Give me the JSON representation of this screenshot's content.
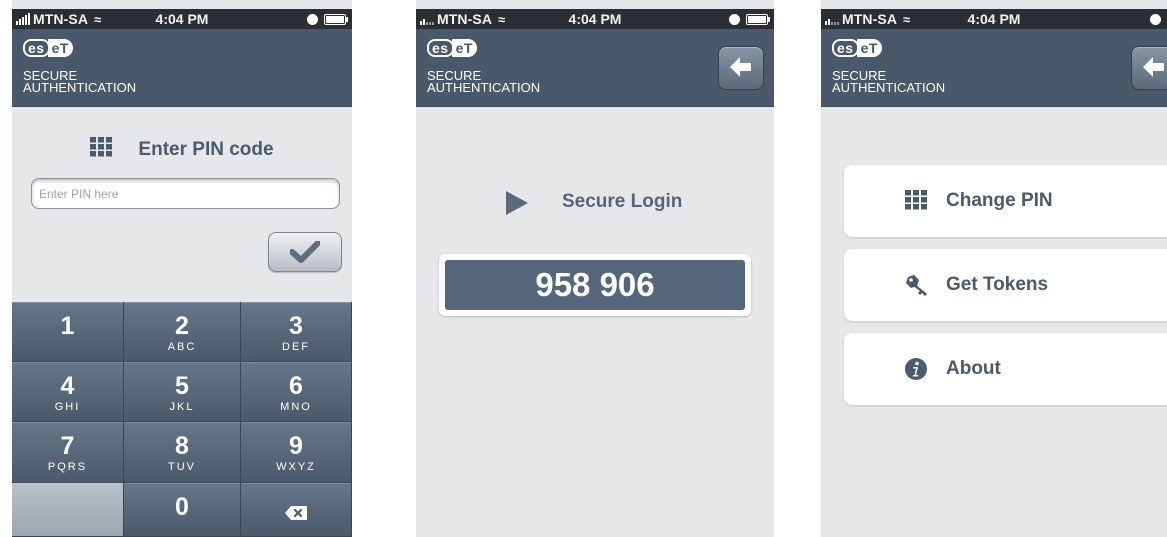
{
  "status_bar": {
    "screen1": {
      "carrier": "MTN-SA",
      "time": "4:04 PM"
    },
    "screen2": {
      "carrier": "MTN-SA",
      "time": "4:04 PM"
    },
    "screen3": {
      "carrier": "MTN-SA",
      "time": "4:04 PM"
    }
  },
  "header": {
    "logo_left": "es",
    "logo_right": "eT",
    "brand_line1": "SECURE",
    "brand_line2": "AUTHENTICATION",
    "back_icon": "left-arrow-icon"
  },
  "pin_screen": {
    "title": "Enter PIN code",
    "title_icon": "keypad-grid-icon",
    "input_placeholder": "Enter PIN here",
    "input_value": "",
    "confirm_icon": "checkmark-icon",
    "keys": [
      {
        "num": "1",
        "letters": ""
      },
      {
        "num": "2",
        "letters": "ABC"
      },
      {
        "num": "3",
        "letters": "DEF"
      },
      {
        "num": "4",
        "letters": "GHI"
      },
      {
        "num": "5",
        "letters": "JKL"
      },
      {
        "num": "6",
        "letters": "MNO"
      },
      {
        "num": "7",
        "letters": "PQRS"
      },
      {
        "num": "8",
        "letters": "TUV"
      },
      {
        "num": "9",
        "letters": "WXYZ"
      },
      {
        "num": "0",
        "letters": ""
      }
    ],
    "backspace_icon": "backspace-icon"
  },
  "login_screen": {
    "label": "Secure Login",
    "label_icon": "play-icon",
    "code": "958 906"
  },
  "menu_screen": {
    "items": [
      {
        "label": "Change PIN",
        "icon": "keypad-grid-icon"
      },
      {
        "label": "Get Tokens",
        "icon": "key-icon"
      },
      {
        "label": "About",
        "icon": "info-icon"
      }
    ]
  },
  "colors": {
    "header": "#49586a",
    "accent_text": "#4b5a6c",
    "code_background": "#56667a",
    "screen_background": "#e6e7e8"
  }
}
